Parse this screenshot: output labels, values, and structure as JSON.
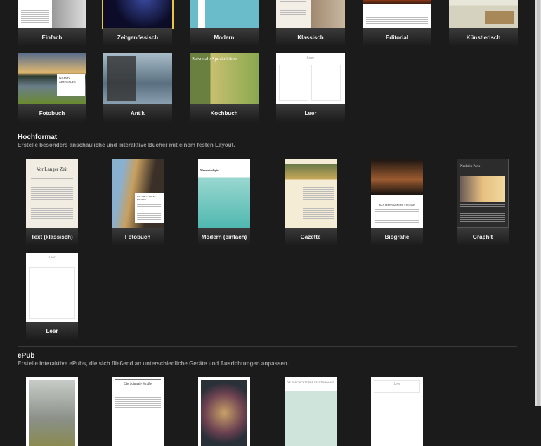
{
  "landscape": {
    "templates": [
      {
        "label": "Einfach"
      },
      {
        "label": "Zeitgenössisch",
        "selected": true
      },
      {
        "label": "Modern"
      },
      {
        "label": "Klassisch"
      },
      {
        "label": "Editorial"
      },
      {
        "label": "Künstlerisch"
      },
      {
        "label": "Fotobuch",
        "thumb_text": "ISLAND-ABENTEUER"
      },
      {
        "label": "Antik"
      },
      {
        "label": "Kochbuch",
        "thumb_text": "Saisonale Spezialitäten"
      },
      {
        "label": "Leer",
        "thumb_text": "Leer"
      }
    ]
  },
  "portrait": {
    "title": "Hochformat",
    "subtitle": "Erstelle besonders anschauliche und interaktive Bücher mit einem festen Layout.",
    "templates": [
      {
        "label": "Text (klassisch)",
        "thumb_text": "Vor Langer Zeit"
      },
      {
        "label": "Fotobuch",
        "thumb_text": "NACHHALTIGES DESIGN"
      },
      {
        "label": "Modern (einfach)",
        "thumb_text": "Meeresbiologie"
      },
      {
        "label": "Gazette"
      },
      {
        "label": "Biografie",
        "thumb_text": "DAS LEBEN AUF DER STRASSE"
      },
      {
        "label": "Graphit",
        "thumb_text": "Nacht in Paris"
      },
      {
        "label": "Leer",
        "thumb_text": "Leer"
      }
    ]
  },
  "epub": {
    "title": "ePub",
    "subtitle": "Erstelle interaktive ePubs, die sich fließend an unterschiedliche Geräte und Ausrichtungen anpassen.",
    "templates": [
      {},
      {
        "thumb_text": "Die Schmale Straße"
      },
      {},
      {
        "thumb_text": "DIE GESCHICHTE DER STADTPLANUNG"
      },
      {
        "thumb_text": "Leer"
      }
    ]
  },
  "colors": {
    "background": "#1b1b1b",
    "selection": "#e8c83a"
  }
}
